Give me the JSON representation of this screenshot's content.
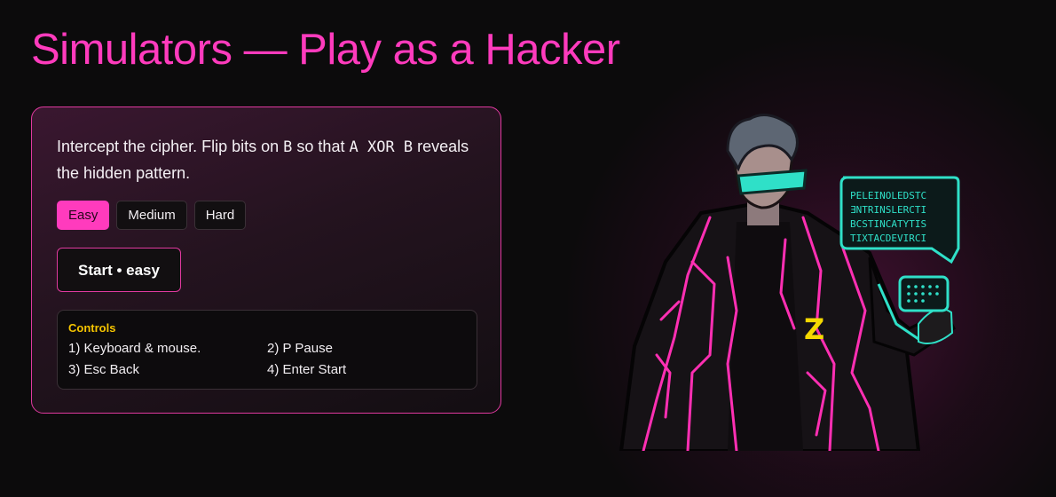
{
  "page": {
    "title": "Simulators — Play as a Hacker"
  },
  "card": {
    "desc_pre": "Intercept the cipher. Flip bits on",
    "desc_b": "B",
    "desc_mid": "so that",
    "desc_expr": "A XOR B",
    "desc_post": "reveals the hidden pattern.",
    "difficulties": [
      "Easy",
      "Medium",
      "Hard"
    ],
    "selected_difficulty": "Easy",
    "start_label": "Start • easy",
    "controls": {
      "title": "Controls",
      "items": [
        "1) Keyboard & mouse.",
        "2) P Pause",
        "3) Esc Back",
        "4) Enter Start"
      ]
    }
  },
  "hero": {
    "panel_lines": [
      "PELEINOLEDSTC",
      "ƎNTRINSLERCTI",
      "BCSTINCATYTIS",
      "TIXTACDEVIRCI"
    ],
    "badge": "Z",
    "colors": {
      "accent": "#ff3bbd",
      "cyan": "#2fe0c8",
      "badge": "#f5d800"
    }
  },
  "colors": {
    "brand": "#ff3bbd",
    "background": "#0c0b0c",
    "controls_title": "#f5c400"
  }
}
